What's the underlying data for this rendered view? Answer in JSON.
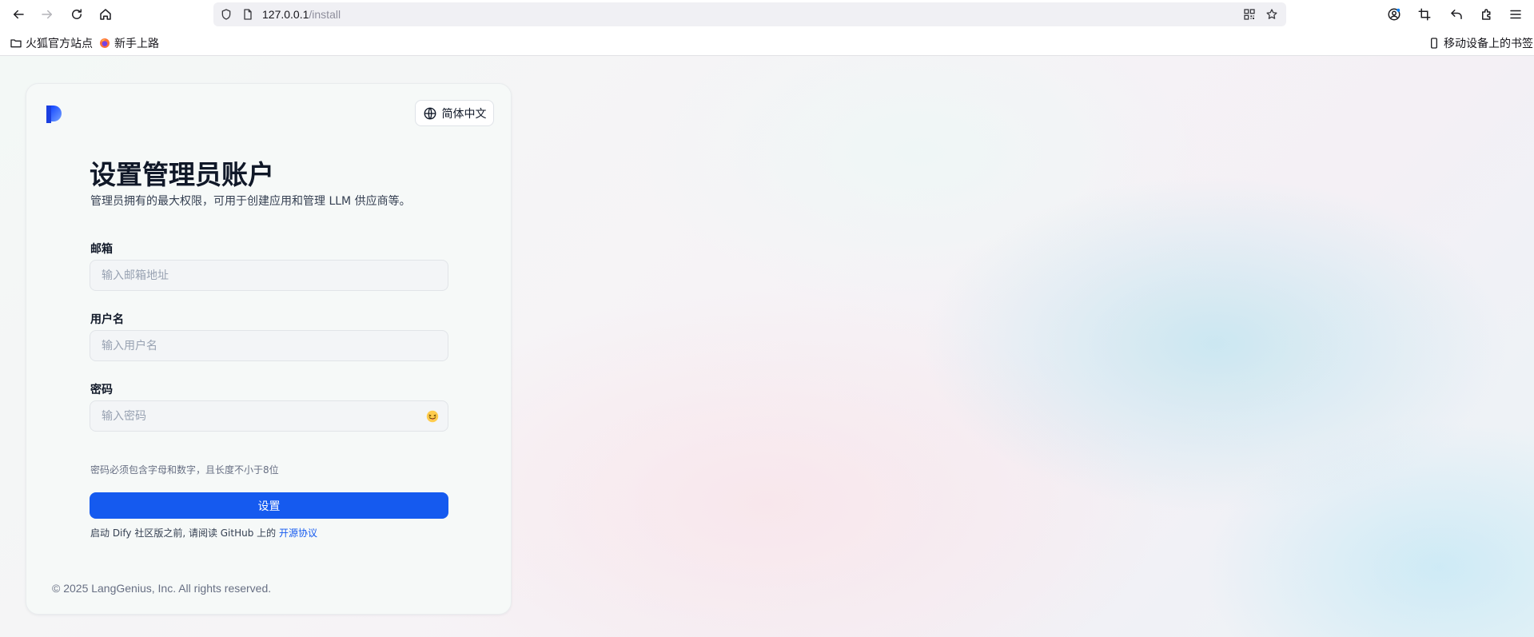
{
  "browser": {
    "url_host": "127.0.0.1",
    "url_path": "/install",
    "bookmarks": [
      {
        "label": "火狐官方站点",
        "icon": "folder-icon"
      },
      {
        "label": "新手上路",
        "icon": "firefox-icon"
      }
    ],
    "mobile_bookmarks_label": "移动设备上的书签"
  },
  "page": {
    "language_label": "简体中文",
    "title": "设置管理员账户",
    "subtitle": "管理员拥有的最大权限，可用于创建应用和管理 LLM 供应商等。",
    "email": {
      "label": "邮箱",
      "placeholder": "输入邮箱地址",
      "value": ""
    },
    "username": {
      "label": "用户名",
      "placeholder": "输入用户名",
      "value": ""
    },
    "password": {
      "label": "密码",
      "placeholder": "输入密码",
      "value": "",
      "toggle_emoji": "😝",
      "hint": "密码必须包含字母和数字，且长度不小于8位"
    },
    "submit_label": "设置",
    "license_prefix": "启动 Dify 社区版之前, 请阅读 GitHub 上的",
    "license_link": "开源协议",
    "footer": "© 2025 LangGenius, Inc. All rights reserved.",
    "colors": {
      "primary": "#155aef",
      "title": "#101828",
      "muted": "#676f83"
    }
  }
}
